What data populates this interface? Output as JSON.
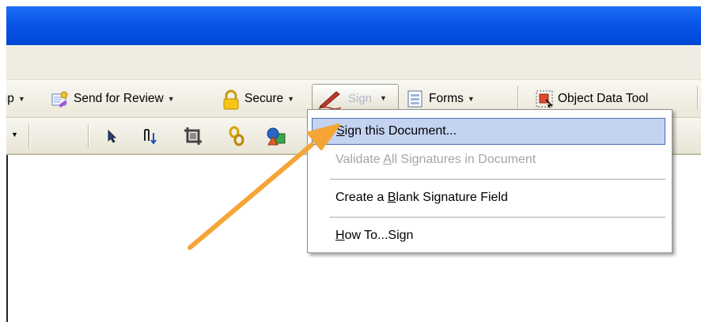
{
  "toolbar": {
    "comment_markup_label": "Comment & Markup",
    "send_for_review_label": "Send for Review",
    "secure_label": "Secure",
    "sign_label": "Sign",
    "forms_label": "Forms",
    "object_data_tool_label": "Object Data Tool"
  },
  "sign_menu": {
    "items": [
      {
        "pre": "",
        "key": "S",
        "post": "ign this Document...",
        "state": "highlighted"
      },
      {
        "pre": "Validate ",
        "key": "A",
        "post": "ll Signatures in Document",
        "state": "disabled"
      },
      {
        "pre": "Create a ",
        "key": "B",
        "post": "lank Signature Field",
        "state": "normal"
      },
      {
        "pre": "",
        "key": "H",
        "post": "ow To...Sign",
        "state": "normal"
      }
    ]
  },
  "colors": {
    "titlebar": "#0a55e8",
    "toolbar_bg": "#ece9d8",
    "menu_highlight": "#c3d3f0",
    "annotation_arrow": "#f5a536"
  },
  "icons": {
    "review": "send-for-review-icon",
    "secure": "padlock-icon",
    "sign": "pen-icon",
    "forms": "forms-icon",
    "object": "object-data-tool-icon"
  }
}
